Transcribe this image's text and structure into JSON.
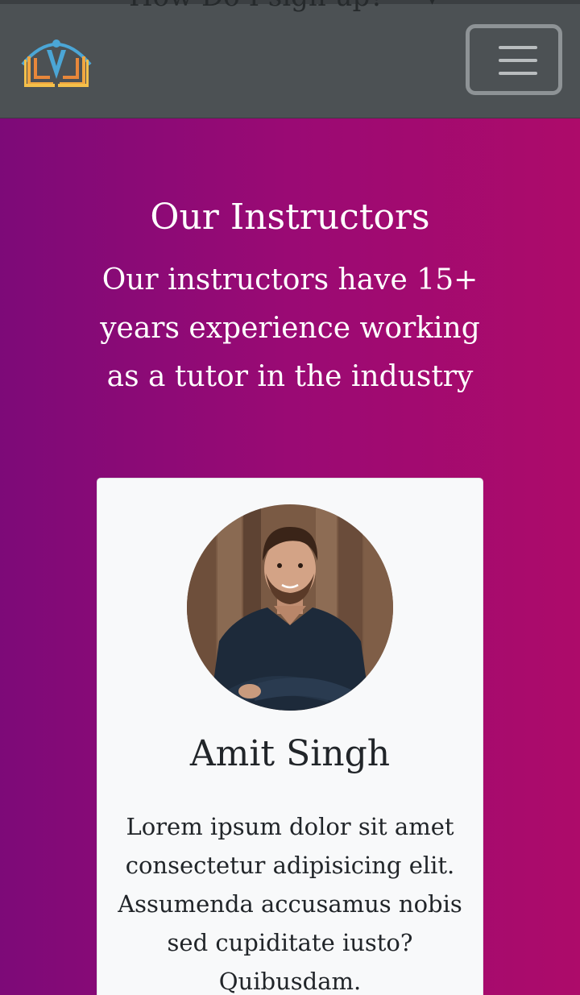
{
  "navbar": {
    "ghost_text": "How Do I sign up?",
    "toggler_label": "Toggle navigation",
    "logo_alt": "Tutoring logo"
  },
  "hero": {
    "title": "Our Instructors",
    "subtitle": "Our instructors have 15+ years experience working as a tutor in the industry"
  },
  "instructor_card": {
    "name": "Amit Singh",
    "bio": "Lorem ipsum dolor sit amet consectetur adipisicing elit. Assumenda accusamus nobis sed cupiditate iusto? Quibusdam.",
    "photo_alt": "Amit Singh portrait"
  },
  "colors": {
    "navbar_bg": "#4c5154",
    "gradient_start": "#7d0a78",
    "gradient_end": "#ad0b6a",
    "card_bg": "#f8f9fa",
    "logo_arc": "#4ba6d6",
    "logo_book": "#f0a640"
  }
}
